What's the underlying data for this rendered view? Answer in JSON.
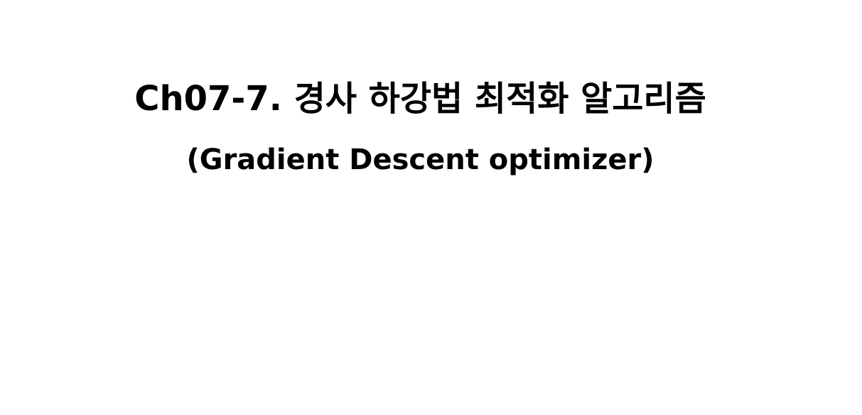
{
  "slide": {
    "title": "Ch07-7. 경사 하강법 최적화 알고리즘",
    "subtitle": "(Gradient Descent optimizer)"
  }
}
